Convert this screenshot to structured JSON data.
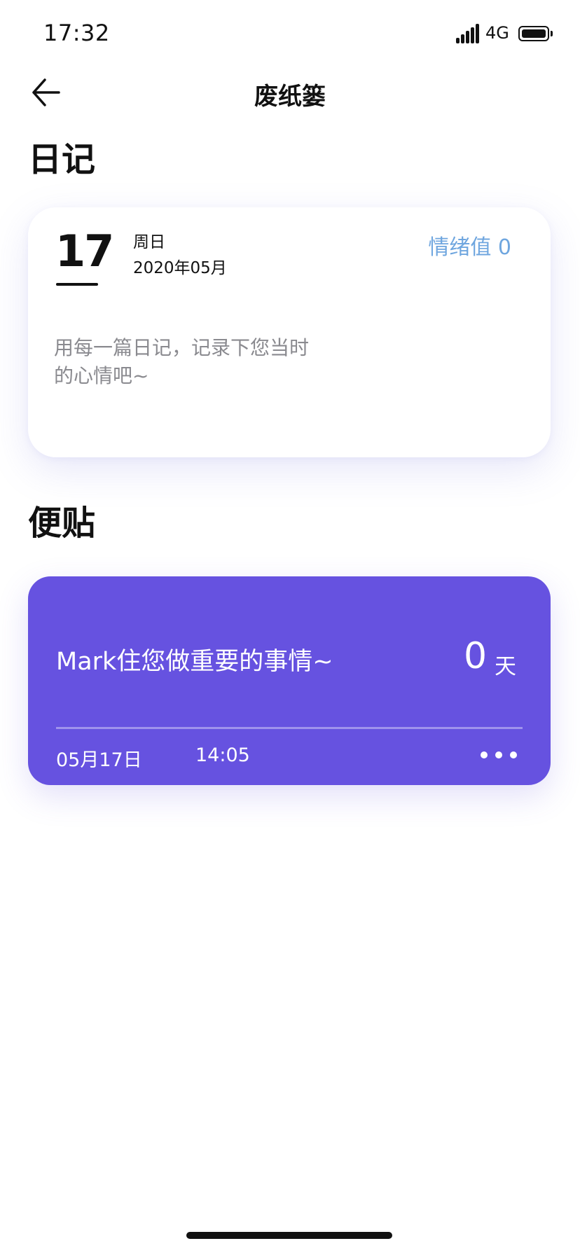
{
  "status_bar": {
    "time": "17:32",
    "network": "4G",
    "icons": [
      "signal-icon",
      "battery-icon"
    ]
  },
  "nav": {
    "back_icon": "arrow-left-icon",
    "title": "废纸篓"
  },
  "diary_section": {
    "heading": "日记",
    "card": {
      "day": "17",
      "weekday": "周日",
      "year_month": "2020年05月",
      "mood": "情绪值 0",
      "placeholder": "用每一篇日记，记录下您当时的心情吧~"
    }
  },
  "notes_section": {
    "heading": "便贴",
    "card": {
      "text": "Mark住您做重要的事情~",
      "days_count": "0",
      "days_unit": "天",
      "date": "05月17日",
      "time": "14:05",
      "more_icon": "more-dots-icon"
    }
  },
  "colors": {
    "note_card_bg": "#6652e0",
    "mood_text": "#6fa6df",
    "placeholder_text": "#8a8a8f"
  }
}
